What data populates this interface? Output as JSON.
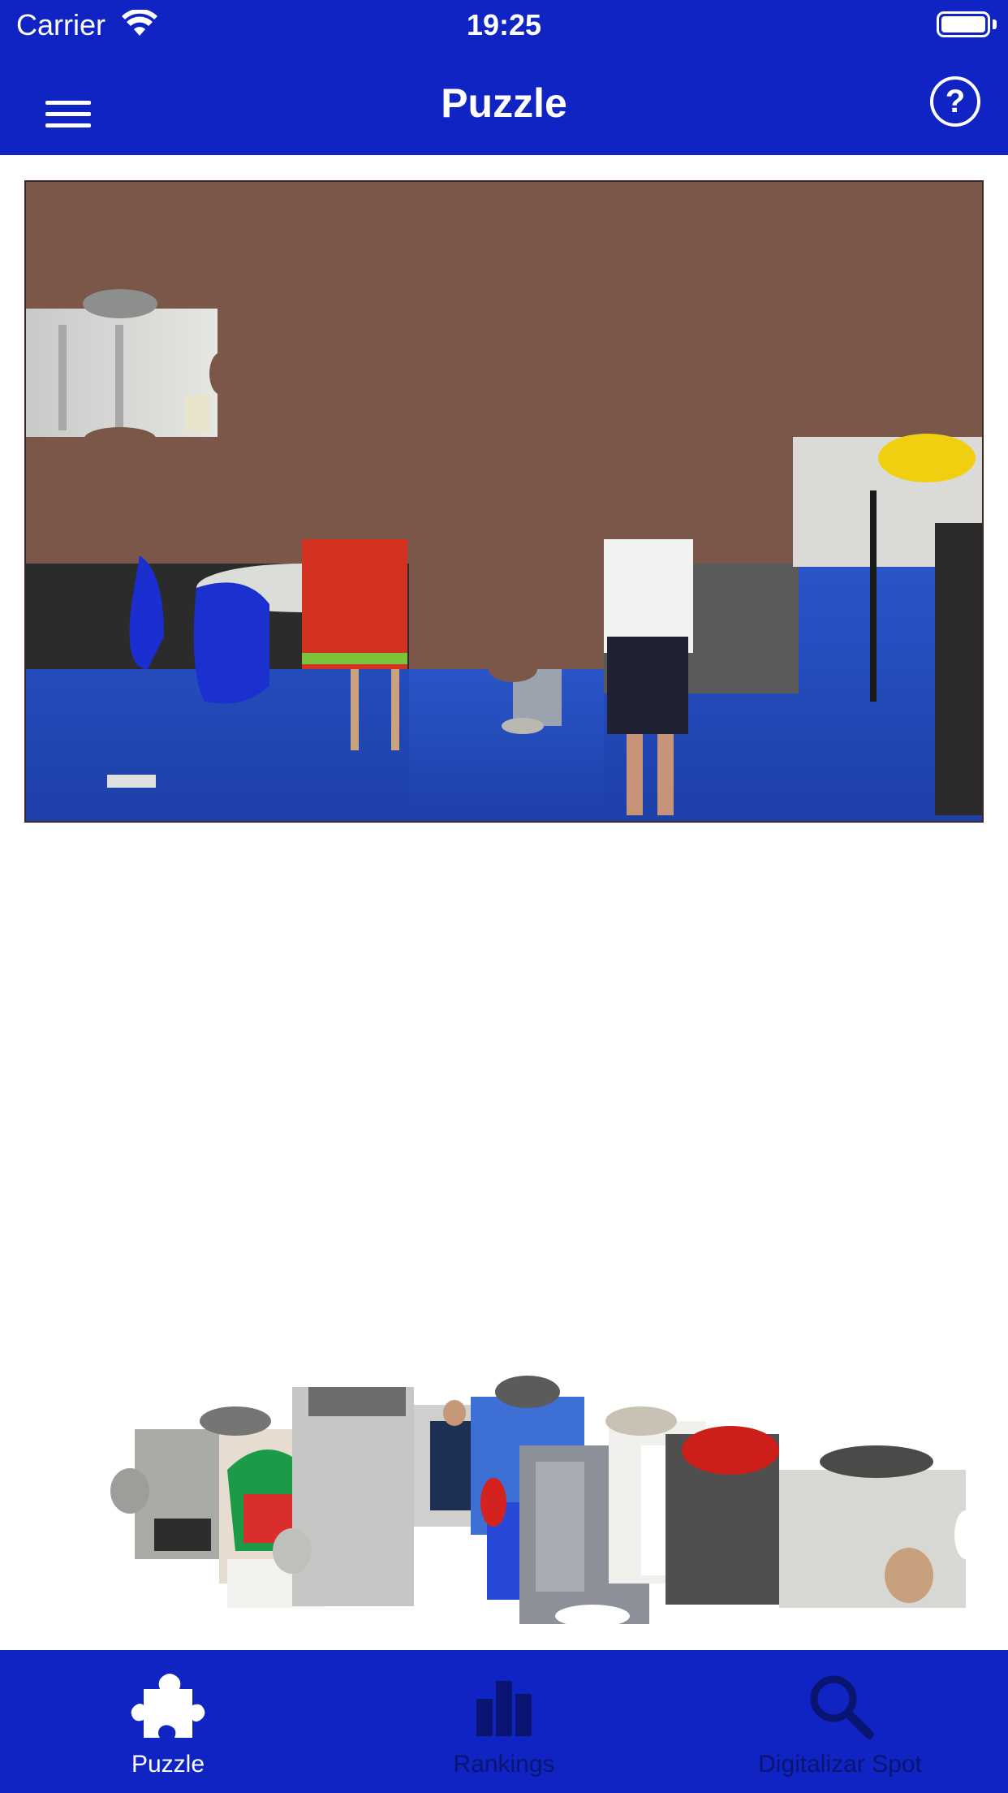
{
  "status_bar": {
    "carrier": "Carrier",
    "time": "19:25"
  },
  "nav": {
    "title": "Puzzle",
    "menu_icon": "hamburger-menu-icon",
    "help_icon": "question-circle-icon",
    "help_glyph": "?"
  },
  "colors": {
    "bar_blue": "#0f24c2",
    "board_brown": "#7b574a",
    "inactive_tab": "#0a1571",
    "active_tab": "#ffffff"
  },
  "tabs": [
    {
      "label": "Puzzle",
      "icon": "puzzle-piece-icon",
      "active": true
    },
    {
      "label": "Rankings",
      "icon": "bar-chart-icon",
      "active": false
    },
    {
      "label": "Digitalizar Spot",
      "icon": "search-icon",
      "active": false
    }
  ]
}
